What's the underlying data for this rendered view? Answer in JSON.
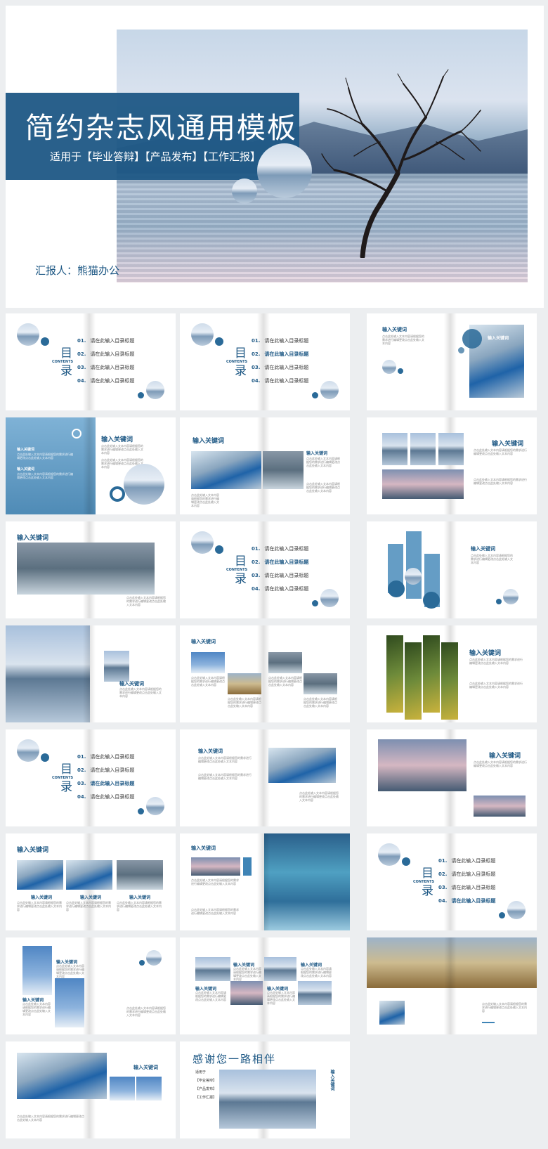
{
  "cover": {
    "title": "简约杂志风通用模板",
    "subtitle": "适用于【毕业答辩】【产品发布】【工作汇报】",
    "presenter": "汇报人：熊猫办公"
  },
  "toc": {
    "title_top": "目",
    "title_bottom": "录",
    "contents_label": "CONTENTS",
    "items": [
      {
        "num": "01.",
        "label": "请在此输入目录标题"
      },
      {
        "num": "02.",
        "label": "请在此输入目录标题"
      },
      {
        "num": "03.",
        "label": "请在此输入目录标题"
      },
      {
        "num": "04.",
        "label": "请在此输入目录标题"
      }
    ]
  },
  "keyword": "输入关键词",
  "body_text": "点击此处输入文本内容请根据您的需求进行编辑更改点击此处输入文本内容",
  "thanks": {
    "title": "感谢您一路相伴",
    "tags": [
      "适用于",
      "【毕业答辩】",
      "【产品发布】",
      "【工作汇报】"
    ]
  },
  "colors": {
    "accent": "#205a86",
    "background": "#eceef0"
  }
}
